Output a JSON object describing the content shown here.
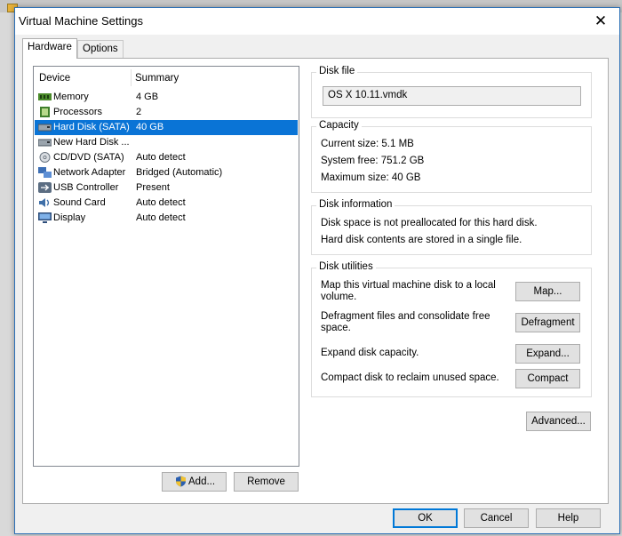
{
  "window": {
    "title": "Virtual Machine Settings",
    "close_glyph": "✕"
  },
  "tabs": [
    {
      "label": "Hardware"
    },
    {
      "label": "Options"
    }
  ],
  "device_list": {
    "columns": {
      "device": "Device",
      "summary": "Summary"
    },
    "rows": [
      {
        "device": "Memory",
        "summary": "4 GB",
        "icon": "memory-icon"
      },
      {
        "device": "Processors",
        "summary": "2",
        "icon": "processor-icon"
      },
      {
        "device": "Hard Disk (SATA)",
        "summary": "40 GB",
        "icon": "hard-disk-icon",
        "selected": true
      },
      {
        "device": "New Hard Disk ...",
        "summary": "",
        "icon": "hard-disk-icon"
      },
      {
        "device": "CD/DVD (SATA)",
        "summary": "Auto detect",
        "icon": "cd-dvd-icon"
      },
      {
        "device": "Network Adapter",
        "summary": "Bridged (Automatic)",
        "icon": "network-adapter-icon"
      },
      {
        "device": "USB Controller",
        "summary": "Present",
        "icon": "usb-icon"
      },
      {
        "device": "Sound Card",
        "summary": "Auto detect",
        "icon": "sound-card-icon"
      },
      {
        "device": "Display",
        "summary": "Auto detect",
        "icon": "display-icon"
      }
    ]
  },
  "list_buttons": {
    "add": "Add...",
    "remove": "Remove"
  },
  "disk_file": {
    "title": "Disk file",
    "value": "OS X 10.11.vmdk"
  },
  "capacity": {
    "title": "Capacity",
    "current_size": "Current size:  5.1 MB",
    "system_free": "System free:  751.2 GB",
    "maximum_size": "Maximum size:  40 GB"
  },
  "disk_information": {
    "title": "Disk information",
    "line1": "Disk space is not preallocated for this hard disk.",
    "line2": "Hard disk contents are stored in a single file."
  },
  "disk_utilities": {
    "title": "Disk utilities",
    "map_text": "Map this virtual machine disk to a local volume.",
    "map_button": "Map...",
    "defrag_text": "Defragment files and consolidate free space.",
    "defrag_button": "Defragment",
    "expand_text": "Expand disk capacity.",
    "expand_button": "Expand...",
    "compact_text": "Compact disk to reclaim unused space.",
    "compact_button": "Compact"
  },
  "advanced_button": "Advanced...",
  "footer": {
    "ok": "OK",
    "cancel": "Cancel",
    "help": "Help"
  },
  "colors": {
    "selection": "#0a74d6",
    "accent": "#0078d7"
  }
}
